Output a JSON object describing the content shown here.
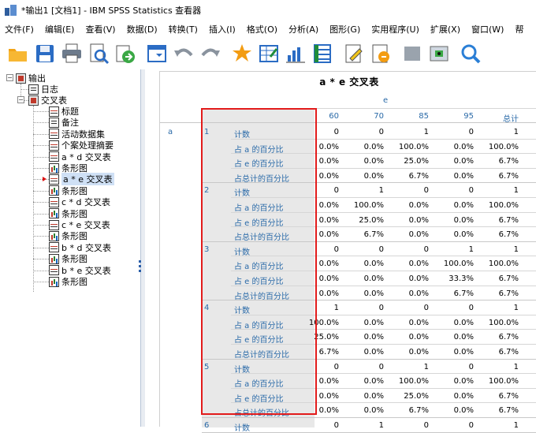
{
  "window": {
    "title": "*输出1 [文档1] - IBM SPSS Statistics 查看器"
  },
  "menu": [
    "文件(F)",
    "编辑(E)",
    "查看(V)",
    "数据(D)",
    "转换(T)",
    "插入(I)",
    "格式(O)",
    "分析(A)",
    "图形(G)",
    "实用程序(U)",
    "扩展(X)",
    "窗口(W)",
    "帮"
  ],
  "toolbar": {
    "icons": [
      "open-folder-icon",
      "save-icon",
      "print-icon",
      "print-preview-icon",
      "export-icon",
      "dialog-recall-icon",
      "undo-icon",
      "redo-icon",
      "goto-data-icon",
      "goto-case-icon",
      "variables-icon",
      "insert-table-icon",
      "edit-icon",
      "script-icon",
      "hide-icon",
      "show-icon",
      "search-icon"
    ]
  },
  "outline": {
    "root": "输出",
    "log": "日志",
    "crosstab_group": "交叉表",
    "items": [
      {
        "label": "标题",
        "icon": "tbl"
      },
      {
        "label": "备注",
        "icon": "log"
      },
      {
        "label": "活动数据集",
        "icon": "tbl"
      },
      {
        "label": "个案处理摘要",
        "icon": "tbl"
      },
      {
        "label": "a * d 交叉表",
        "icon": "tbl"
      },
      {
        "label": "条形图",
        "icon": "chart"
      },
      {
        "label": "a * e 交叉表",
        "icon": "tbl",
        "selected": true
      },
      {
        "label": "条形图",
        "icon": "chart"
      },
      {
        "label": "c * d 交叉表",
        "icon": "tbl"
      },
      {
        "label": "条形图",
        "icon": "chart"
      },
      {
        "label": "c * e 交叉表",
        "icon": "tbl"
      },
      {
        "label": "条形图",
        "icon": "chart"
      },
      {
        "label": "b * d 交叉表",
        "icon": "tbl"
      },
      {
        "label": "条形图",
        "icon": "chart"
      },
      {
        "label": "b * e 交叉表",
        "icon": "tbl"
      },
      {
        "label": "条形图",
        "icon": "chart"
      }
    ]
  },
  "table": {
    "title": "a * e 交叉表",
    "col_var": "e",
    "row_var": "a",
    "columns": [
      "60",
      "70",
      "85",
      "95",
      "总计"
    ],
    "stats": [
      "计数",
      "占 a 的百分比",
      "占 e 的百分比",
      "占总计的百分比"
    ],
    "groups": [
      {
        "code": "1",
        "rows": [
          [
            "0",
            "0",
            "1",
            "0",
            "1"
          ],
          [
            "0.0%",
            "0.0%",
            "100.0%",
            "0.0%",
            "100.0%"
          ],
          [
            "0.0%",
            "0.0%",
            "25.0%",
            "0.0%",
            "6.7%"
          ],
          [
            "0.0%",
            "0.0%",
            "6.7%",
            "0.0%",
            "6.7%"
          ]
        ]
      },
      {
        "code": "2",
        "rows": [
          [
            "0",
            "1",
            "0",
            "0",
            "1"
          ],
          [
            "0.0%",
            "100.0%",
            "0.0%",
            "0.0%",
            "100.0%"
          ],
          [
            "0.0%",
            "25.0%",
            "0.0%",
            "0.0%",
            "6.7%"
          ],
          [
            "0.0%",
            "6.7%",
            "0.0%",
            "0.0%",
            "6.7%"
          ]
        ]
      },
      {
        "code": "3",
        "rows": [
          [
            "0",
            "0",
            "0",
            "1",
            "1"
          ],
          [
            "0.0%",
            "0.0%",
            "0.0%",
            "100.0%",
            "100.0%"
          ],
          [
            "0.0%",
            "0.0%",
            "0.0%",
            "33.3%",
            "6.7%"
          ],
          [
            "0.0%",
            "0.0%",
            "0.0%",
            "6.7%",
            "6.7%"
          ]
        ]
      },
      {
        "code": "4",
        "rows": [
          [
            "1",
            "0",
            "0",
            "0",
            "1"
          ],
          [
            "100.0%",
            "0.0%",
            "0.0%",
            "0.0%",
            "100.0%"
          ],
          [
            "25.0%",
            "0.0%",
            "0.0%",
            "0.0%",
            "6.7%"
          ],
          [
            "6.7%",
            "0.0%",
            "0.0%",
            "0.0%",
            "6.7%"
          ]
        ]
      },
      {
        "code": "5",
        "rows": [
          [
            "0",
            "0",
            "1",
            "0",
            "1"
          ],
          [
            "0.0%",
            "0.0%",
            "100.0%",
            "0.0%",
            "100.0%"
          ],
          [
            "0.0%",
            "0.0%",
            "25.0%",
            "0.0%",
            "6.7%"
          ],
          [
            "0.0%",
            "0.0%",
            "6.7%",
            "0.0%",
            "6.7%"
          ]
        ]
      },
      {
        "code": "6",
        "rows": [
          [
            "0",
            "1",
            "0",
            "0",
            "1"
          ]
        ]
      }
    ]
  }
}
